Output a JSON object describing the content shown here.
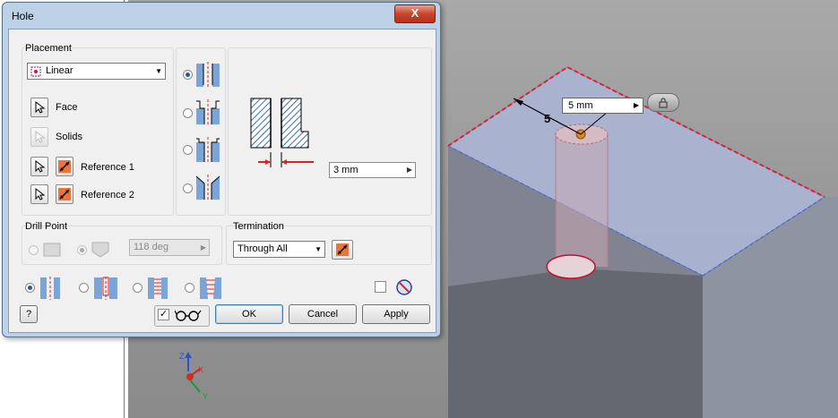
{
  "dialog": {
    "title": "Hole",
    "close_glyph": "X",
    "placement": {
      "label": "Placement",
      "type_value": "Linear",
      "face_label": "Face",
      "solids_label": "Solids",
      "reference1_label": "Reference 1",
      "reference2_label": "Reference 2"
    },
    "hole_preview": {
      "diameter_value": "3 mm"
    },
    "drill_point": {
      "label": "Drill Point",
      "angle_value": "118 deg"
    },
    "termination": {
      "label": "Termination",
      "value": "Through All"
    },
    "buttons": {
      "help": "?",
      "ok": "OK",
      "cancel": "Cancel",
      "apply": "Apply"
    },
    "preview_checked": "✓"
  },
  "viewport": {
    "depth_value": "5 mm",
    "dimension_label": "5",
    "triad": {
      "z": "Z",
      "x": "X",
      "y": "Y"
    }
  },
  "colors": {
    "dialog_frame": "#bcd0e6",
    "close_red": "#c8452d",
    "part_face": "#a9b3cf",
    "selected_edge": "#e02030",
    "radio_on": "#1d5aa8"
  }
}
